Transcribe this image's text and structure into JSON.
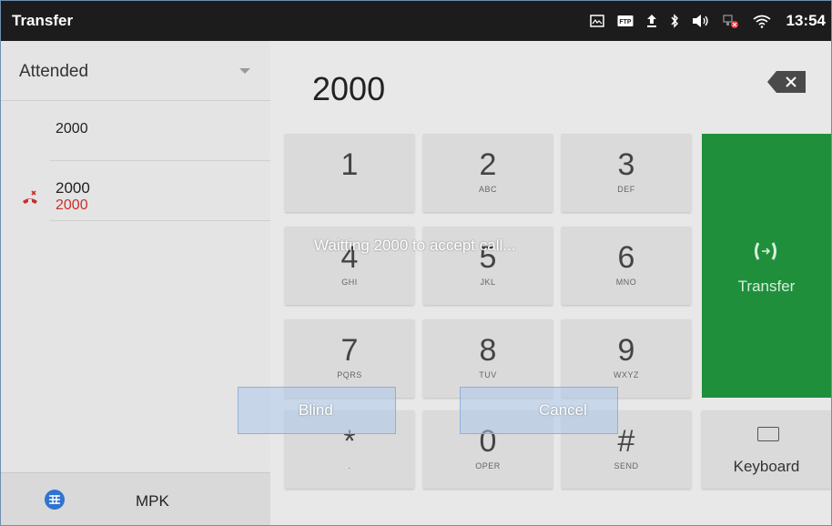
{
  "statusbar": {
    "title": "Transfer",
    "icons": [
      "screenshot-icon",
      "ftp-icon",
      "upload-icon",
      "bluetooth-icon",
      "volume-icon",
      "network-icon",
      "wifi-icon"
    ],
    "ftp_label": "FTP",
    "time": "13:54"
  },
  "left": {
    "mode_label": "Attended",
    "number": "2000",
    "call": {
      "name": "2000",
      "number": "2000",
      "status_color": "#c9302c"
    },
    "mpk_label": "MPK"
  },
  "dialer": {
    "entered": "2000",
    "keys": [
      {
        "digit": "1",
        "letters": ""
      },
      {
        "digit": "2",
        "letters": "ABC"
      },
      {
        "digit": "3",
        "letters": "DEF"
      },
      {
        "digit": "4",
        "letters": "GHI"
      },
      {
        "digit": "5",
        "letters": "JKL"
      },
      {
        "digit": "6",
        "letters": "MNO"
      },
      {
        "digit": "7",
        "letters": "PQRS"
      },
      {
        "digit": "8",
        "letters": "TUV"
      },
      {
        "digit": "9",
        "letters": "WXYZ"
      },
      {
        "digit": "*",
        "letters": "."
      },
      {
        "digit": "0",
        "letters": "OPER"
      },
      {
        "digit": "#",
        "letters": "SEND"
      }
    ],
    "transfer_label": "Transfer",
    "keyboard_label": "Keyboard",
    "accent": "#1f8f3c"
  },
  "dialog": {
    "message": "Waitting 2000 to accept call...",
    "blind_label": "Blind",
    "cancel_label": "Cancel"
  }
}
